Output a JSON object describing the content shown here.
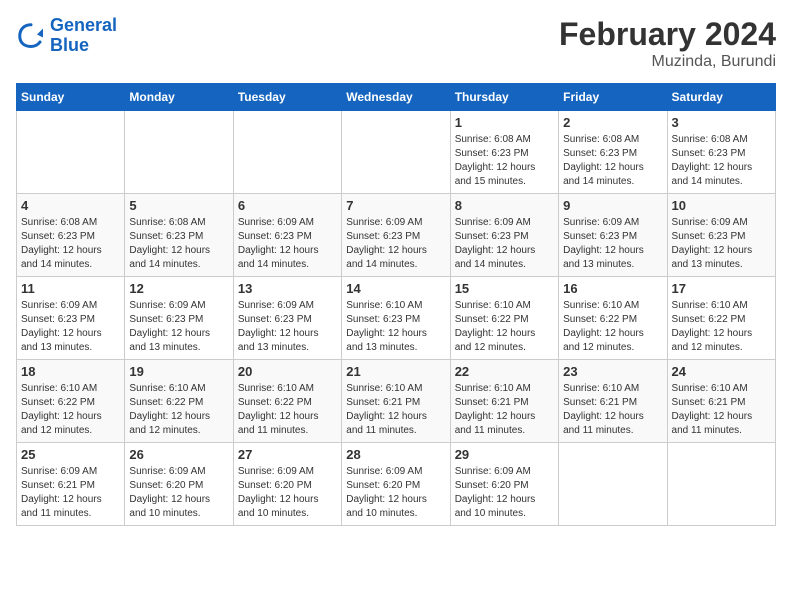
{
  "header": {
    "logo_line1": "General",
    "logo_line2": "Blue",
    "title": "February 2024",
    "subtitle": "Muzinda, Burundi"
  },
  "days_of_week": [
    "Sunday",
    "Monday",
    "Tuesday",
    "Wednesday",
    "Thursday",
    "Friday",
    "Saturday"
  ],
  "weeks": [
    [
      {
        "day": "",
        "info": ""
      },
      {
        "day": "",
        "info": ""
      },
      {
        "day": "",
        "info": ""
      },
      {
        "day": "",
        "info": ""
      },
      {
        "day": "1",
        "info": "Sunrise: 6:08 AM\nSunset: 6:23 PM\nDaylight: 12 hours\nand 15 minutes."
      },
      {
        "day": "2",
        "info": "Sunrise: 6:08 AM\nSunset: 6:23 PM\nDaylight: 12 hours\nand 14 minutes."
      },
      {
        "day": "3",
        "info": "Sunrise: 6:08 AM\nSunset: 6:23 PM\nDaylight: 12 hours\nand 14 minutes."
      }
    ],
    [
      {
        "day": "4",
        "info": "Sunrise: 6:08 AM\nSunset: 6:23 PM\nDaylight: 12 hours\nand 14 minutes."
      },
      {
        "day": "5",
        "info": "Sunrise: 6:08 AM\nSunset: 6:23 PM\nDaylight: 12 hours\nand 14 minutes."
      },
      {
        "day": "6",
        "info": "Sunrise: 6:09 AM\nSunset: 6:23 PM\nDaylight: 12 hours\nand 14 minutes."
      },
      {
        "day": "7",
        "info": "Sunrise: 6:09 AM\nSunset: 6:23 PM\nDaylight: 12 hours\nand 14 minutes."
      },
      {
        "day": "8",
        "info": "Sunrise: 6:09 AM\nSunset: 6:23 PM\nDaylight: 12 hours\nand 14 minutes."
      },
      {
        "day": "9",
        "info": "Sunrise: 6:09 AM\nSunset: 6:23 PM\nDaylight: 12 hours\nand 13 minutes."
      },
      {
        "day": "10",
        "info": "Sunrise: 6:09 AM\nSunset: 6:23 PM\nDaylight: 12 hours\nand 13 minutes."
      }
    ],
    [
      {
        "day": "11",
        "info": "Sunrise: 6:09 AM\nSunset: 6:23 PM\nDaylight: 12 hours\nand 13 minutes."
      },
      {
        "day": "12",
        "info": "Sunrise: 6:09 AM\nSunset: 6:23 PM\nDaylight: 12 hours\nand 13 minutes."
      },
      {
        "day": "13",
        "info": "Sunrise: 6:09 AM\nSunset: 6:23 PM\nDaylight: 12 hours\nand 13 minutes."
      },
      {
        "day": "14",
        "info": "Sunrise: 6:10 AM\nSunset: 6:23 PM\nDaylight: 12 hours\nand 13 minutes."
      },
      {
        "day": "15",
        "info": "Sunrise: 6:10 AM\nSunset: 6:22 PM\nDaylight: 12 hours\nand 12 minutes."
      },
      {
        "day": "16",
        "info": "Sunrise: 6:10 AM\nSunset: 6:22 PM\nDaylight: 12 hours\nand 12 minutes."
      },
      {
        "day": "17",
        "info": "Sunrise: 6:10 AM\nSunset: 6:22 PM\nDaylight: 12 hours\nand 12 minutes."
      }
    ],
    [
      {
        "day": "18",
        "info": "Sunrise: 6:10 AM\nSunset: 6:22 PM\nDaylight: 12 hours\nand 12 minutes."
      },
      {
        "day": "19",
        "info": "Sunrise: 6:10 AM\nSunset: 6:22 PM\nDaylight: 12 hours\nand 12 minutes."
      },
      {
        "day": "20",
        "info": "Sunrise: 6:10 AM\nSunset: 6:22 PM\nDaylight: 12 hours\nand 11 minutes."
      },
      {
        "day": "21",
        "info": "Sunrise: 6:10 AM\nSunset: 6:21 PM\nDaylight: 12 hours\nand 11 minutes."
      },
      {
        "day": "22",
        "info": "Sunrise: 6:10 AM\nSunset: 6:21 PM\nDaylight: 12 hours\nand 11 minutes."
      },
      {
        "day": "23",
        "info": "Sunrise: 6:10 AM\nSunset: 6:21 PM\nDaylight: 12 hours\nand 11 minutes."
      },
      {
        "day": "24",
        "info": "Sunrise: 6:10 AM\nSunset: 6:21 PM\nDaylight: 12 hours\nand 11 minutes."
      }
    ],
    [
      {
        "day": "25",
        "info": "Sunrise: 6:09 AM\nSunset: 6:21 PM\nDaylight: 12 hours\nand 11 minutes."
      },
      {
        "day": "26",
        "info": "Sunrise: 6:09 AM\nSunset: 6:20 PM\nDaylight: 12 hours\nand 10 minutes."
      },
      {
        "day": "27",
        "info": "Sunrise: 6:09 AM\nSunset: 6:20 PM\nDaylight: 12 hours\nand 10 minutes."
      },
      {
        "day": "28",
        "info": "Sunrise: 6:09 AM\nSunset: 6:20 PM\nDaylight: 12 hours\nand 10 minutes."
      },
      {
        "day": "29",
        "info": "Sunrise: 6:09 AM\nSunset: 6:20 PM\nDaylight: 12 hours\nand 10 minutes."
      },
      {
        "day": "",
        "info": ""
      },
      {
        "day": "",
        "info": ""
      }
    ]
  ]
}
